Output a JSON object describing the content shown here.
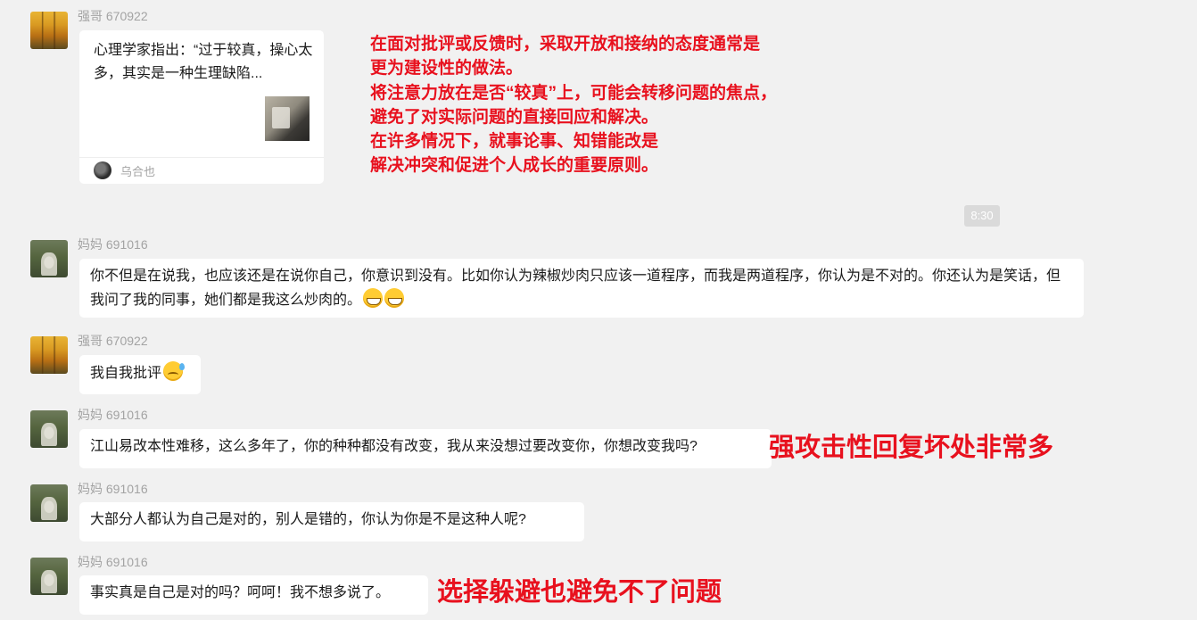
{
  "messages": [
    {
      "sender": "强哥 670922"
    },
    {
      "sender": "妈妈 691016",
      "text": "你不但是在说我，也应该还是在说你自己，你意识到没有。比如你认为辣椒炒肉只应该一道程序，而我是两道程序，你认为是不对的。你还认为是笑话，但我问了我的同事，她们都是我这么炒肉的。"
    },
    {
      "sender": "强哥 670922",
      "text": "我自我批评"
    },
    {
      "sender": "妈妈 691016",
      "text": "江山易改本性难移，这么多年了，你的种种都没有改变，我从来没想过要改变你，你想改变我吗?"
    },
    {
      "sender": "妈妈 691016",
      "text": "大部分人都认为自己是对的，别人是错的，你认为你是不是这种人呢?"
    },
    {
      "sender": "妈妈 691016",
      "text": "事实真是自己是对的吗？呵呵！我不想多说了。"
    }
  ],
  "shared_card": {
    "title": "心理学家指出：“过于较真，操心太多，其实是一种生理缺陷...",
    "source": "乌合也"
  },
  "timestamp": "8:30",
  "annotations": {
    "main_lines": [
      "在面对批评或反馈时，采取开放和接纳的态度通常是",
      "更为建设性的做法。",
      "将注意力放在是否“较真”上，可能会转移问题的焦点，",
      "避免了对实际问题的直接回应和解决。",
      "在许多情况下，就事论事、知错能改是",
      "解决冲突和促进个人成长的重要原则。"
    ],
    "aggressive_reply": "强攻击性回复坏处非常多",
    "avoidance": "选择躲避也避免不了问题"
  },
  "colors": {
    "background": "#f1f1f1",
    "bubble": "#ffffff",
    "annotation": "#e8111e",
    "sender_name": "#a3a3a3"
  }
}
